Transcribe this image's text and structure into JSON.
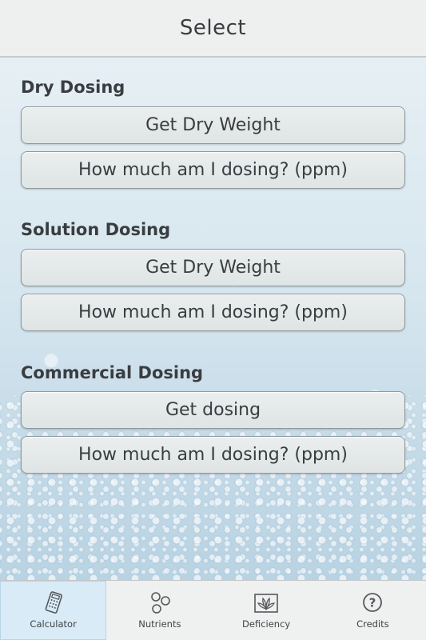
{
  "header": {
    "title": "Select"
  },
  "sections": [
    {
      "heading": "Dry Dosing",
      "buttons": [
        "Get Dry Weight",
        "How much am I dosing? (ppm)"
      ]
    },
    {
      "heading": "Solution Dosing",
      "buttons": [
        "Get Dry Weight",
        "How much am I dosing? (ppm)"
      ]
    },
    {
      "heading": "Commercial Dosing",
      "buttons": [
        "Get dosing",
        "How much am I dosing? (ppm)"
      ]
    }
  ],
  "tabs": [
    {
      "label": "Calculator",
      "icon": "calculator-icon",
      "active": true
    },
    {
      "label": "Nutrients",
      "icon": "nutrients-icon",
      "active": false
    },
    {
      "label": "Deficiency",
      "icon": "deficiency-icon",
      "active": false
    },
    {
      "label": "Credits",
      "icon": "question-icon",
      "active": false
    }
  ],
  "colors": {
    "header_bg": "#eeefef",
    "button_bg": "#e4e8e8",
    "button_border": "#8f9a9c",
    "active_tab_bg": "#d9ebf6",
    "text": "#3a3d40"
  }
}
